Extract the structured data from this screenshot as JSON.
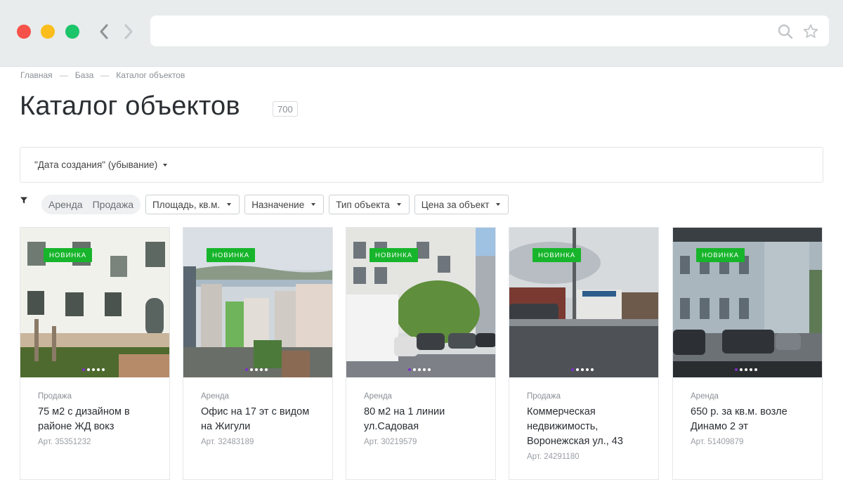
{
  "breadcrumb": [
    {
      "label": "Главная"
    },
    {
      "label": "База"
    },
    {
      "label": "Каталог объектов"
    }
  ],
  "breadcrumb_sep": "—",
  "page": {
    "title": "Каталог объектов",
    "count": "700"
  },
  "sort": {
    "value": "\"Дата создания\" (убывание)"
  },
  "filters": {
    "deal_types": [
      "Аренда",
      "Продажа"
    ],
    "dropdowns": [
      "Площадь, кв.м.",
      "Назначение",
      "Тип объекта",
      "Цена за объект"
    ]
  },
  "cards": [
    {
      "badge": "НОВИНКА",
      "deal": "Продажа",
      "title": "75 м2 с дизайном в районе ЖД вокз",
      "art": "Арт. 35351232"
    },
    {
      "badge": "НОВИНКА",
      "deal": "Аренда",
      "title": "Офис на 17 эт с видом на Жигули",
      "art": "Арт. 32483189"
    },
    {
      "badge": "НОВИНКА",
      "deal": "Аренда",
      "title": "80 м2 на 1 линии ул.Садовая",
      "art": "Арт. 30219579"
    },
    {
      "badge": "НОВИНКА",
      "deal": "Продажа",
      "title": "Коммерческая недвижимость, Воронежская ул., 43",
      "art": "Арт. 24291180"
    },
    {
      "badge": "НОВИНКА",
      "deal": "Аренда",
      "title": "650 р. за кв.м. возле Динамо 2 эт",
      "art": "Арт. 51409879"
    }
  ],
  "colors": {
    "badge_green": "#17b52b",
    "pager_active": "#7b2fc9",
    "chrome_bg": "#e8ecec"
  },
  "icons": [
    "chevron-left-icon",
    "chevron-right-icon",
    "search-icon",
    "star-icon",
    "filter-icon"
  ]
}
